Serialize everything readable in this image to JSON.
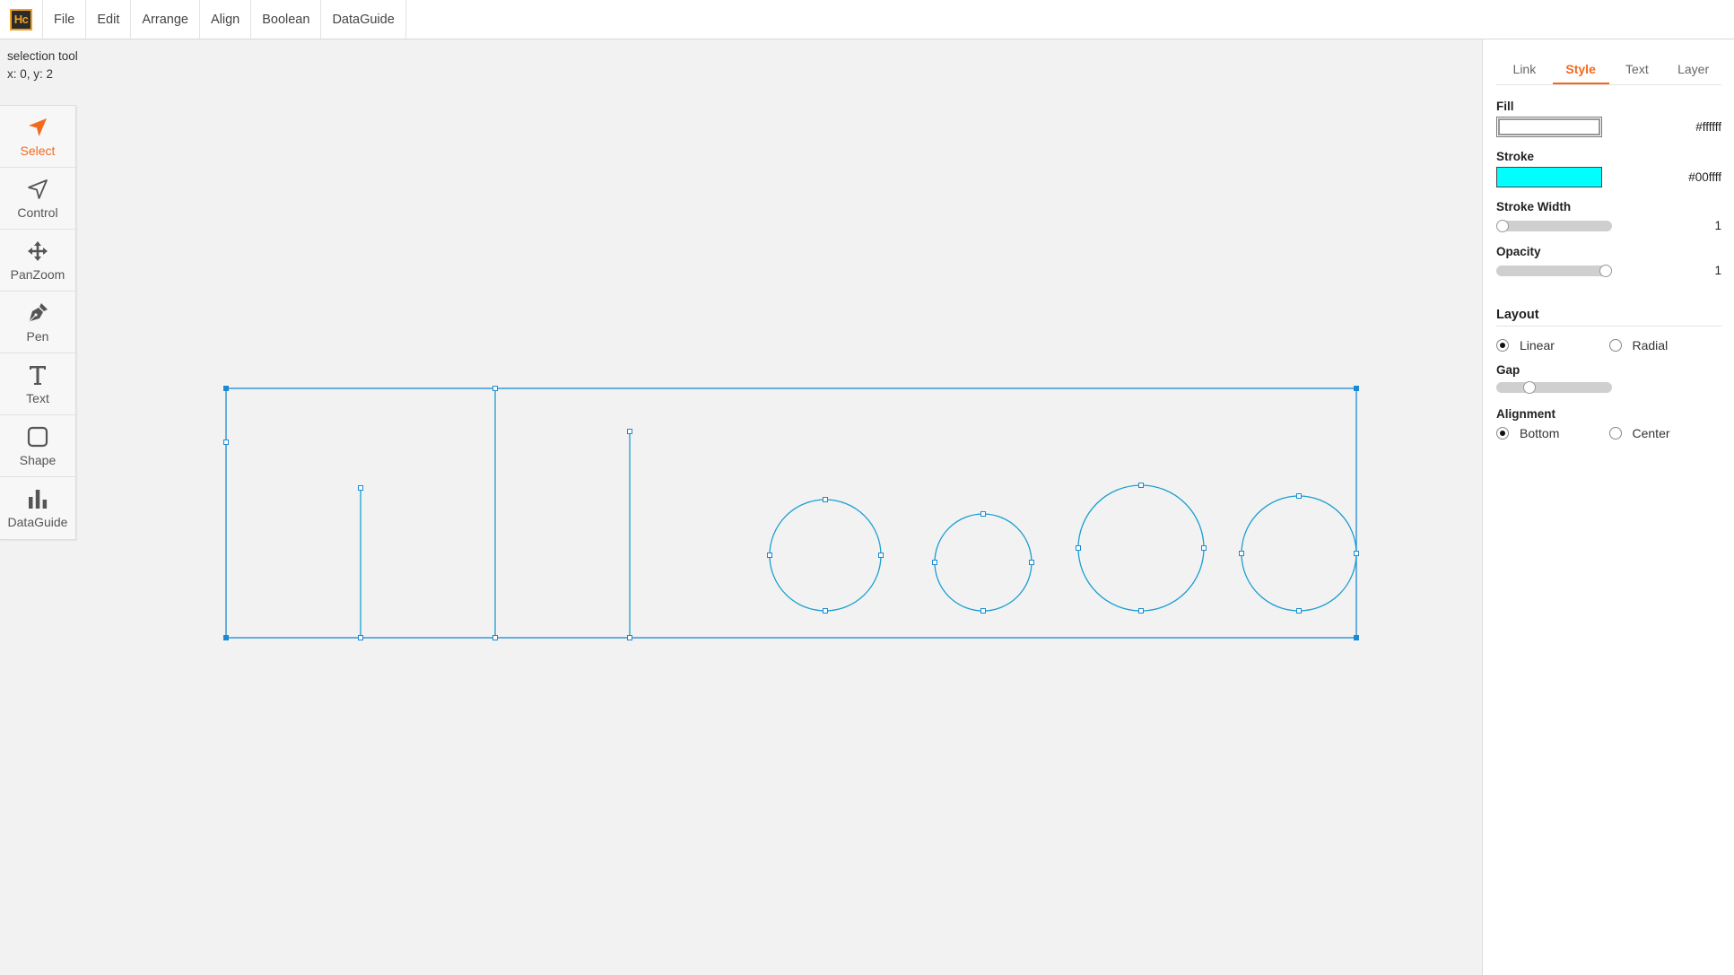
{
  "app": {
    "logo_text": "Hc"
  },
  "menu": [
    "File",
    "Edit",
    "Arrange",
    "Align",
    "Boolean",
    "DataGuide"
  ],
  "status": {
    "tool": "selection tool",
    "coords": "x: 0, y: 2"
  },
  "tools": [
    {
      "label": "Select",
      "icon": "arrow-icon",
      "active": true
    },
    {
      "label": "Control",
      "icon": "navigation-icon"
    },
    {
      "label": "PanZoom",
      "icon": "move-icon"
    },
    {
      "label": "Pen",
      "icon": "pen-icon"
    },
    {
      "label": "Text",
      "icon": "text-icon"
    },
    {
      "label": "Shape",
      "icon": "square-icon"
    },
    {
      "label": "DataGuide",
      "icon": "bar-chart-icon"
    }
  ],
  "panel": {
    "tabs": [
      "Link",
      "Style",
      "Text",
      "Layer"
    ],
    "active_tab": "Style",
    "fill_label": "Fill",
    "fill_value": "#ffffff",
    "stroke_label": "Stroke",
    "stroke_value": "#00ffff",
    "stroke_width_label": "Stroke Width",
    "stroke_width_value": "1",
    "opacity_label": "Opacity",
    "opacity_value": "1",
    "layout_title": "Layout",
    "layout_options": [
      "Linear",
      "Radial"
    ],
    "layout_selected": "Linear",
    "gap_label": "Gap",
    "gap_level": 0.26,
    "alignment_label": "Alignment",
    "alignment_options": [
      "Bottom",
      "Center"
    ],
    "alignment_selected": "Bottom"
  },
  "colors": {
    "accent": "#f26b1d",
    "selection": "#1a8ad4",
    "shape_stroke": "#1a9fd0"
  }
}
